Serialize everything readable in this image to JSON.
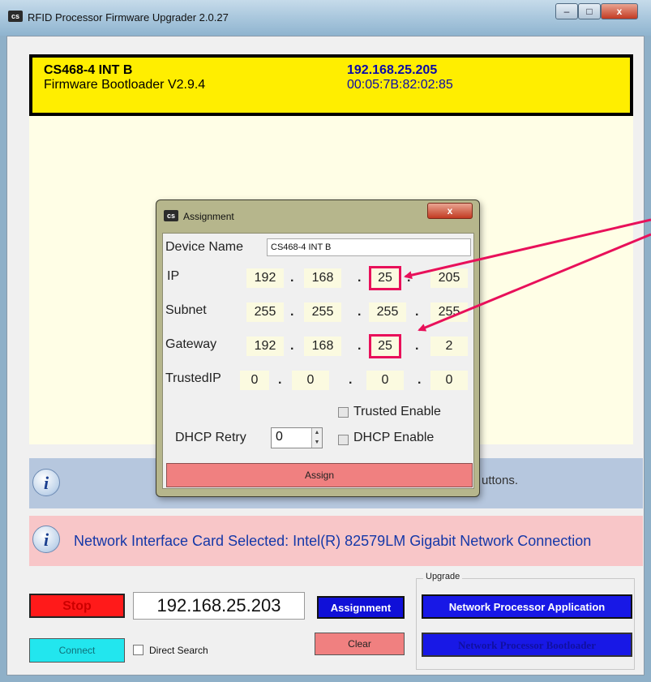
{
  "window": {
    "title": "RFID Processor Firmware Upgrader 2.0.27",
    "app_icon": "cs",
    "controls": {
      "minimize": "–",
      "maximize": "□",
      "close": "x"
    }
  },
  "device": {
    "name": "CS468-4 INT B",
    "bootloader": "Firmware Bootloader V2.9.4",
    "ip": "192.168.25.205",
    "mac": "00:05:7B:82:02:85"
  },
  "info": {
    "message1": "uttons.",
    "message2": "Network Interface Card Selected: Intel(R) 82579LM Gigabit Network Connection",
    "icon_glyph": "i"
  },
  "controls": {
    "stop_label": "Stop",
    "ip_value": "192.168.25.203",
    "assignment_label": "Assignment",
    "connect_label": "Connect",
    "direct_search_label": "Direct Search",
    "clear_label": "Clear",
    "upgrade_legend": "Upgrade",
    "network_processor_app_label": "Network Processor Application",
    "network_processor_boot_label": "Network Processor Bootloader"
  },
  "dialog": {
    "title": "Assignment",
    "close": "x",
    "device_name_label": "Device Name",
    "device_name_value": "CS468-4 INT B",
    "ip_label": "IP",
    "ip": [
      "192",
      "168",
      "25",
      "205"
    ],
    "subnet_label": "Subnet",
    "subnet": [
      "255",
      "255",
      "255",
      "255"
    ],
    "gateway_label": "Gateway",
    "gateway": [
      "192",
      "168",
      "25",
      "2"
    ],
    "trusted_ip_label": "TrustedIP",
    "trusted_ip": [
      "0",
      "0",
      "0",
      "0"
    ],
    "dot": ".",
    "trusted_enable_label": "Trusted Enable",
    "dhcp_retry_label": "DHCP Retry",
    "dhcp_retry_value": "0",
    "dhcp_enable_label": "DHCP Enable",
    "assign_label": "Assign"
  },
  "colors": {
    "device_bar": "#ffee00",
    "highlight": "#e8105a",
    "button_blue": "#1818e6",
    "stop_red": "#ff1a1a",
    "connect_cyan": "#22e6ee",
    "clear_pink": "#f08080"
  }
}
